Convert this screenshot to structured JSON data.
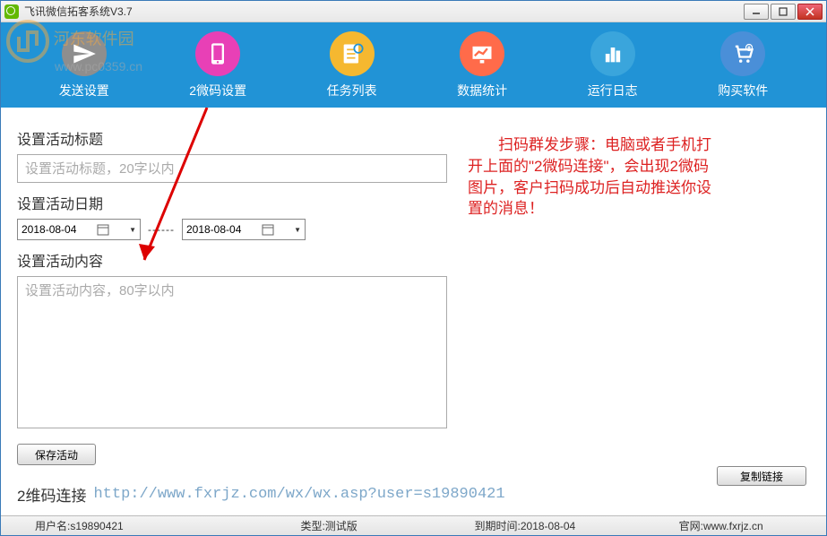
{
  "titlebar": {
    "title": "飞讯微信拓客系统V3.7"
  },
  "watermark": {
    "text": "河东软件园",
    "url": "www.pc0359.cn"
  },
  "toolbar": {
    "items": [
      {
        "label": "发送设置",
        "color": "#8e8e8e",
        "icon": "send"
      },
      {
        "label": "2微码设置",
        "color": "#e840b6",
        "icon": "phone"
      },
      {
        "label": "任务列表",
        "color": "#f5b830",
        "icon": "list"
      },
      {
        "label": "数据统计",
        "color": "#ff6b4a",
        "icon": "chart"
      },
      {
        "label": "运行日志",
        "color": "#3aa5dc",
        "icon": "bars"
      },
      {
        "label": "购买软件",
        "color": "#4a8fd8",
        "icon": "cart"
      }
    ]
  },
  "form": {
    "title_label": "设置活动标题",
    "title_placeholder": "设置活动标题，20字以内",
    "date_label": "设置活动日期",
    "date_start": "2018-08-04",
    "date_sep": "------",
    "date_end": "2018-08-04",
    "content_label": "设置活动内容",
    "content_placeholder": "设置活动内容，80字以内",
    "save_button": "保存活动",
    "link_label": "2维码连接",
    "link_url": "http://www.fxrjz.com/wx/wx.asp?user=s19890421",
    "copy_button": "复制链接"
  },
  "instruction": "扫码群发步骤：电脑或者手机打开上面的\"2微码连接\"，会出现2微码图片，客户扫码成功后自动推送你设置的消息！",
  "statusbar": {
    "user": "用户名:s19890421",
    "type": "类型:测试版",
    "expire": "到期时间:2018-08-04",
    "site": "官网:www.fxrjz.cn"
  }
}
